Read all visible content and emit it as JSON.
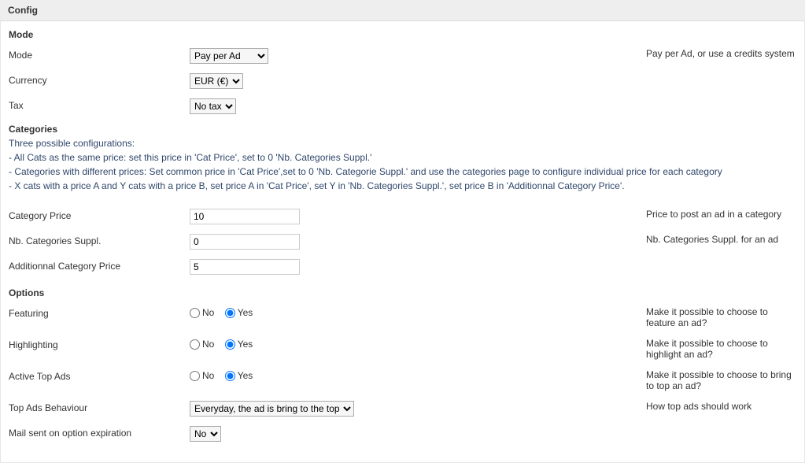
{
  "page_title": "Config",
  "sections": {
    "mode": {
      "heading": "Mode",
      "mode_field": {
        "label": "Mode",
        "value": "Pay per Ad",
        "help": "Pay per Ad, or use a credits system"
      },
      "currency_field": {
        "label": "Currency",
        "value": "EUR (€)"
      },
      "tax_field": {
        "label": "Tax",
        "value": "No tax"
      }
    },
    "categories": {
      "heading": "Categories",
      "desc_line1": "Three possible configurations:",
      "desc_line2": "- All Cats as the same price: set this price in 'Cat Price', set to 0 'Nb. Categories Suppl.'",
      "desc_line3": "- Categories with different prices: Set common price in 'Cat Price',set to 0 'Nb. Categorie Suppl.' and use the categories page to configure individual price for each category",
      "desc_line4": "- X cats with a price A and Y cats with a price B, set price A in 'Cat Price', set Y in 'Nb. Categories Suppl.', set price B in 'Additionnal Category Price'.",
      "category_price": {
        "label": "Category Price",
        "value": "10",
        "help": "Price to post an ad in a category"
      },
      "nb_suppl": {
        "label": "Nb. Categories Suppl.",
        "value": "0",
        "help": "Nb. Categories Suppl. for an ad"
      },
      "addl_price": {
        "label": "Additionnal Category Price",
        "value": "5"
      }
    },
    "options": {
      "heading": "Options",
      "yes": "Yes",
      "no": "No",
      "featuring": {
        "label": "Featuring",
        "help": "Make it possible to choose to feature an ad?"
      },
      "highlighting": {
        "label": "Highlighting",
        "help": "Make it possible to choose to highlight an ad?"
      },
      "active_top": {
        "label": "Active Top Ads",
        "help": "Make it possible to choose to bring to top an ad?"
      },
      "top_behaviour": {
        "label": "Top Ads Behaviour",
        "value": "Everyday, the ad is bring to the top",
        "help": "How top ads should work"
      },
      "mail_expiration": {
        "label": "Mail sent on option expiration",
        "value": "No"
      }
    }
  }
}
